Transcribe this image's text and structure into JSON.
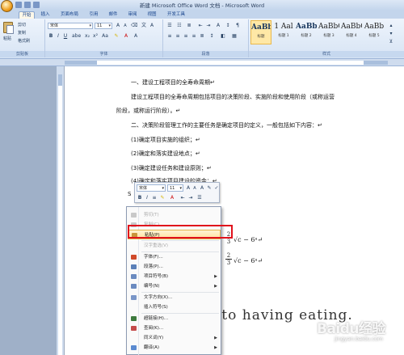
{
  "window": {
    "title": "新建 Microsoft Office Word 文档 - Microsoft Word"
  },
  "tabs": [
    "开始",
    "插入",
    "页面布局",
    "引用",
    "邮件",
    "审阅",
    "视图",
    "开发工具"
  ],
  "ribbon": {
    "clipboard": {
      "paste": "粘贴",
      "cut": "剪切",
      "copy": "复制",
      "format_painter": "格式刷",
      "label": "剪贴板"
    },
    "font": {
      "name": "宋体",
      "size": "11",
      "label": "字体"
    },
    "paragraph": {
      "label": "段落"
    },
    "styles": {
      "label": "样式",
      "items": [
        {
          "sample": "AaBbC",
          "name": "标题"
        },
        {
          "sample": "1 Aal",
          "name": "标题 1"
        },
        {
          "sample": "AaBb",
          "name": "标题 2"
        },
        {
          "sample": "AaBbC",
          "name": "标题 3"
        },
        {
          "sample": "AaBbC",
          "name": "标题 4"
        },
        {
          "sample": "AaBb",
          "name": "标题 5"
        }
      ]
    }
  },
  "document": {
    "lines": [
      "一、建设工程项目的全寿命周期↵",
      "建设工程项目的全寿命周期包括项目的决策阶段、实施阶段和使用阶段（或称运营",
      "阶段，或称运行阶段）。↵",
      "二、决策阶段管理工作的主要任务是确定项目的定义，一般包括如下内容：↵",
      "(1)确定项目实施的组织；↵",
      "(2)确定和落实建设地点；↵",
      "(3)确定建设任务和建设原则；↵",
      "(4)确定和落实项目建设的资金；↵"
    ],
    "math1": {
      "num": "2",
      "den": "3",
      "expr": "√c − 6ᵃ↵"
    },
    "math2": {
      "num": "2",
      "den": "3",
      "expr": "√c − 6ᵃ↵"
    },
    "english_text": "g to having eating.",
    "fragment_s": "S"
  },
  "mini_toolbar": {
    "font": "宋体",
    "size": "11"
  },
  "context_menu": {
    "items": [
      {
        "label": "剪切(T)",
        "enabled": false
      },
      {
        "label": "复制(C)",
        "enabled": false
      },
      {
        "label": "粘贴(P)",
        "enabled": true,
        "highlighted": true
      },
      {
        "label": "汉字重选(V)",
        "enabled": false
      },
      {
        "label": "字体(F)...",
        "enabled": true
      },
      {
        "label": "段落(P)...",
        "enabled": true
      },
      {
        "label": "项目符号(B)",
        "enabled": true,
        "submenu": true
      },
      {
        "label": "编号(N)",
        "enabled": true,
        "submenu": true
      },
      {
        "label": "文字方向(X)...",
        "enabled": true
      },
      {
        "label": "插入符号(S)",
        "enabled": true
      },
      {
        "label": "超链接(H)...",
        "enabled": true
      },
      {
        "label": "查阅(K)...",
        "enabled": true
      },
      {
        "label": "同义词(Y)",
        "enabled": true,
        "submenu": true
      },
      {
        "label": "翻译(A)",
        "enabled": true,
        "submenu": true
      },
      {
        "label": "其他操作(E)",
        "enabled": true,
        "submenu": true
      }
    ]
  },
  "watermark": {
    "logo": "Baidu经验",
    "url": "jingyan.baidu.com"
  },
  "colors": {
    "highlight_box": "#e0111c",
    "ribbon": "#d7e4f4",
    "menu_highlight": "#ffe2a0"
  }
}
